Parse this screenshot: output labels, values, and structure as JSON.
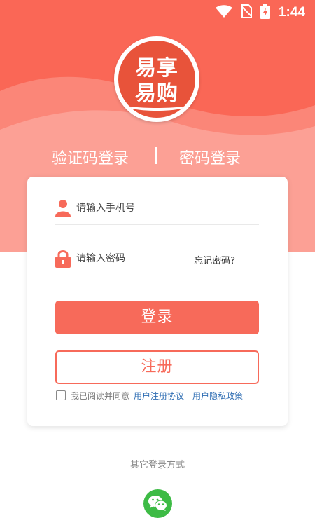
{
  "colors": {
    "brand": "#f76a5a",
    "logo": "#e8533a",
    "link": "#2e6db3",
    "wechat": "#3dbb45"
  },
  "status_bar": {
    "time": "1:44",
    "icons": [
      "wifi-icon",
      "no-sim-icon",
      "battery-charging-icon"
    ]
  },
  "logo": {
    "line1": "易享",
    "line2": "易购"
  },
  "tabs": {
    "sms_login": "验证码登录",
    "password_login": "密码登录"
  },
  "form": {
    "phone_placeholder": "请输入手机号",
    "password_placeholder": "请输入密码",
    "forgot_password": "忘记密码?",
    "login_button": "登录",
    "register_button": "注册"
  },
  "agreement": {
    "checked": false,
    "text": "我已阅读并同意",
    "user_agreement": "用户注册协议",
    "privacy_policy": "用户隐私政策"
  },
  "other_login": {
    "title": "其它登录方式",
    "methods": [
      "wechat-icon"
    ]
  }
}
